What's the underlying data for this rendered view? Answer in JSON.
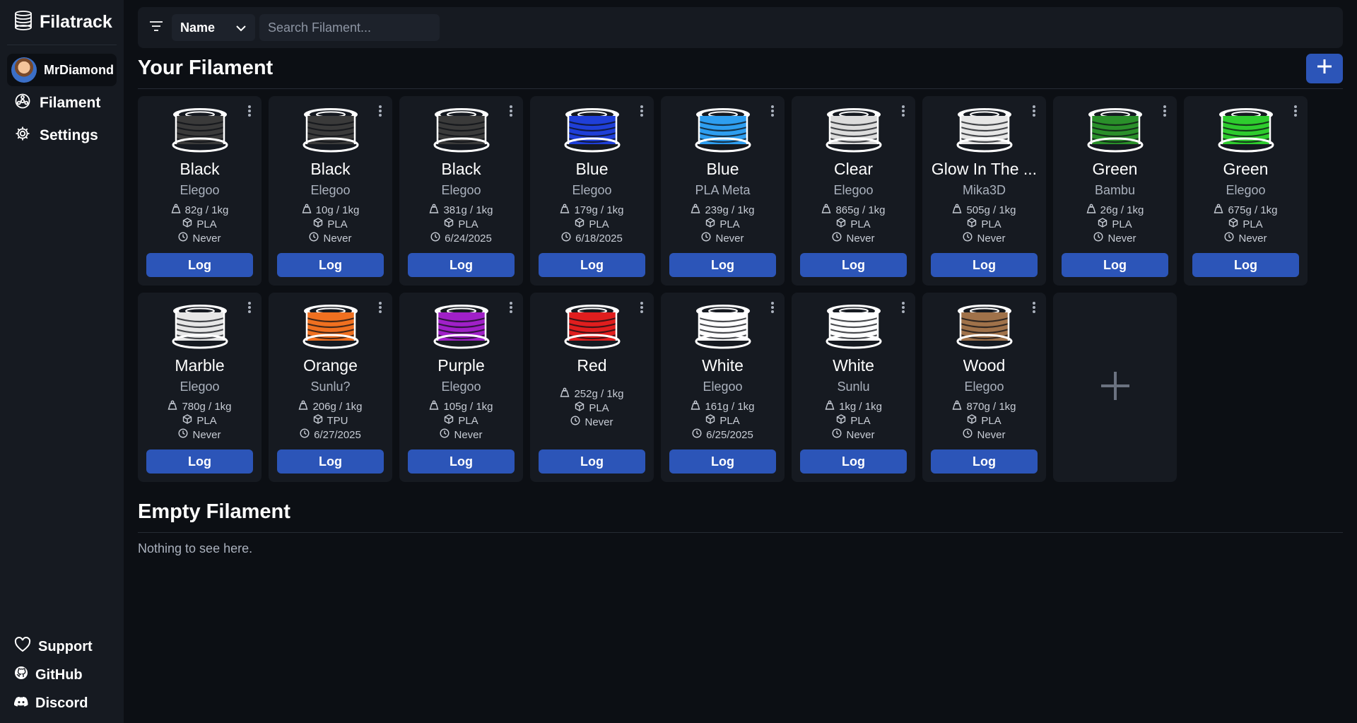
{
  "app": {
    "name": "Filatrack"
  },
  "user": {
    "name": "MrDiamond"
  },
  "nav": [
    {
      "label": "Filament",
      "icon": "filament-reel-icon"
    },
    {
      "label": "Settings",
      "icon": "gear-icon"
    }
  ],
  "footer_nav": [
    {
      "label": "Support",
      "icon": "heart-icon"
    },
    {
      "label": "GitHub",
      "icon": "github-icon"
    },
    {
      "label": "Discord",
      "icon": "discord-icon"
    }
  ],
  "toolbar": {
    "sort_value": "Name",
    "search_placeholder": "Search Filament..."
  },
  "sections": {
    "your_filament": "Your Filament",
    "empty_filament": "Empty Filament",
    "empty_message": "Nothing to see here."
  },
  "log_label": "Log",
  "filaments": [
    {
      "name": "Black",
      "brand": "Elegoo",
      "weight": "82g / 1kg",
      "material": "PLA",
      "last_used": "Never",
      "color": "#3a3a3a"
    },
    {
      "name": "Black",
      "brand": "Elegoo",
      "weight": "10g / 1kg",
      "material": "PLA",
      "last_used": "Never",
      "color": "#3a3a3a"
    },
    {
      "name": "Black",
      "brand": "Elegoo",
      "weight": "381g / 1kg",
      "material": "PLA",
      "last_used": "6/24/2025",
      "color": "#3a3a3a"
    },
    {
      "name": "Blue",
      "brand": "Elegoo",
      "weight": "179g / 1kg",
      "material": "PLA",
      "last_used": "6/18/2025",
      "color": "#1f3fd8"
    },
    {
      "name": "Blue",
      "brand": "PLA Meta",
      "weight": "239g / 1kg",
      "material": "PLA",
      "last_used": "Never",
      "color": "#2e9ef0"
    },
    {
      "name": "Clear",
      "brand": "Elegoo",
      "weight": "865g / 1kg",
      "material": "PLA",
      "last_used": "Never",
      "color": "#dcdcdc"
    },
    {
      "name": "Glow In The ...",
      "brand": "Mika3D",
      "weight": "505g / 1kg",
      "material": "PLA",
      "last_used": "Never",
      "color": "#e6e6e6"
    },
    {
      "name": "Green",
      "brand": "Bambu",
      "weight": "26g / 1kg",
      "material": "PLA",
      "last_used": "Never",
      "color": "#2a8f2a"
    },
    {
      "name": "Green",
      "brand": "Elegoo",
      "weight": "675g / 1kg",
      "material": "PLA",
      "last_used": "Never",
      "color": "#2ecc2e"
    },
    {
      "name": "Marble",
      "brand": "Elegoo",
      "weight": "780g / 1kg",
      "material": "PLA",
      "last_used": "Never",
      "color": "#e6e6e6"
    },
    {
      "name": "Orange",
      "brand": "Sunlu?",
      "weight": "206g / 1kg",
      "material": "TPU",
      "last_used": "6/27/2025",
      "color": "#f07020"
    },
    {
      "name": "Purple",
      "brand": "Elegoo",
      "weight": "105g / 1kg",
      "material": "PLA",
      "last_used": "Never",
      "color": "#a020c8"
    },
    {
      "name": "Red",
      "brand": "",
      "weight": "252g / 1kg",
      "material": "PLA",
      "last_used": "Never",
      "color": "#e01e1e"
    },
    {
      "name": "White",
      "brand": "Elegoo",
      "weight": "161g / 1kg",
      "material": "PLA",
      "last_used": "6/25/2025",
      "color": "#ffffff"
    },
    {
      "name": "White",
      "brand": "Sunlu",
      "weight": "1kg / 1kg",
      "material": "PLA",
      "last_used": "Never",
      "color": "#ffffff"
    },
    {
      "name": "Wood",
      "brand": "Elegoo",
      "weight": "870g / 1kg",
      "material": "PLA",
      "last_used": "Never",
      "color": "#a0724a"
    }
  ]
}
